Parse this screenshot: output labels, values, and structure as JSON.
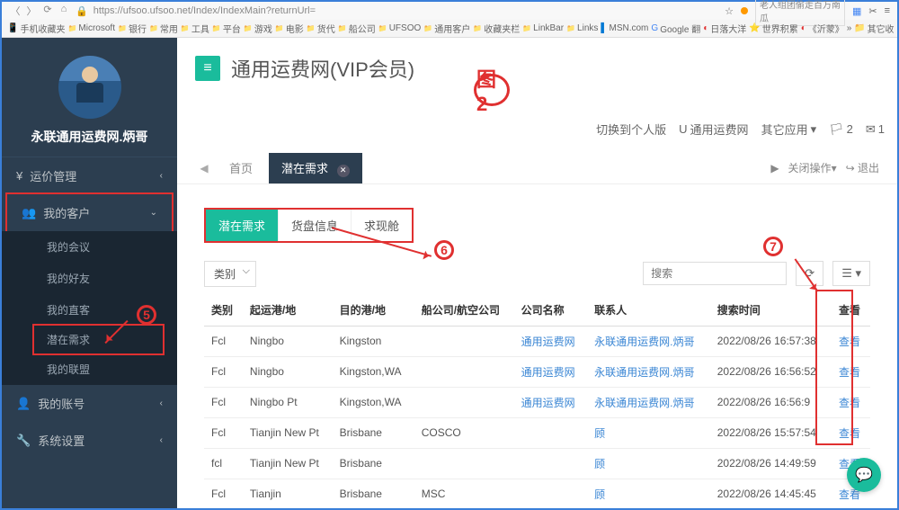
{
  "browser": {
    "url": "https://ufsoo.ufsoo.net/Index/IndexMain?returnUrl=",
    "search_placeholder": "老人组团偷走百万南瓜"
  },
  "bookmarks": [
    "手机收藏夹",
    "Microsoft",
    "银行",
    "常用",
    "工具",
    "平台",
    "游戏",
    "电影",
    "货代",
    "船公司",
    "UFSOO",
    "通用客户",
    "收藏夹栏",
    "LinkBar",
    "Links",
    "MSN.com",
    "Google 翻",
    "日落大洋",
    "世界积累",
    "《沂蒙》",
    "其它收"
  ],
  "profile": {
    "name": "永联通用运费网.炳哥"
  },
  "nav": {
    "freight": "运价管理",
    "customers": "我的客户",
    "customers_items": [
      "我的会议",
      "我的好友",
      "我的直客",
      "潜在需求",
      "我的联盟"
    ],
    "account": "我的账号",
    "settings": "系统设置"
  },
  "header": {
    "title": "通用运费网(VIP会员)",
    "switch": "切换到个人版",
    "ufs": "通用运费网",
    "apps": "其它应用",
    "badge1": "2",
    "badge2": "1"
  },
  "tabs": {
    "home": "首页",
    "active": "潜在需求",
    "close_ops": "关闭操作",
    "logout": "退出"
  },
  "sub_tabs": [
    "潜在需求",
    "货盘信息",
    "求现舱"
  ],
  "filter": {
    "category": "类别",
    "search_placeholder": "搜索"
  },
  "table": {
    "headers": [
      "类别",
      "起运港/地",
      "目的港/地",
      "船公司/航空公司",
      "公司名称",
      "联系人",
      "搜索时间",
      "查看"
    ],
    "rows": [
      {
        "cat": "Fcl",
        "origin": "Ningbo",
        "dest": "Kingston",
        "carrier": "",
        "company": "通用运费网",
        "contact": "永联通用运费网.炳哥",
        "time": "2022/08/26 16:57:38",
        "view": "查看"
      },
      {
        "cat": "Fcl",
        "origin": "Ningbo",
        "dest": "Kingston,WA",
        "carrier": "",
        "company": "通用运费网",
        "contact": "永联通用运费网.炳哥",
        "time": "2022/08/26 16:56:52",
        "view": "查看"
      },
      {
        "cat": "Fcl",
        "origin": "Ningbo Pt",
        "dest": "Kingston,WA",
        "carrier": "",
        "company": "通用运费网",
        "contact": "永联通用运费网.炳哥",
        "time": "2022/08/26 16:56:9",
        "view": "查看"
      },
      {
        "cat": "Fcl",
        "origin": "Tianjin New Pt",
        "dest": "Brisbane",
        "carrier": "COSCO",
        "company": "",
        "contact": "顾",
        "time": "2022/08/26 15:57:54",
        "view": "查看"
      },
      {
        "cat": "fcl",
        "origin": "Tianjin New Pt",
        "dest": "Brisbane",
        "carrier": "",
        "company": "",
        "contact": "顾",
        "time": "2022/08/26 14:49:59",
        "view": "查看"
      },
      {
        "cat": "Fcl",
        "origin": "Tianjin",
        "dest": "Brisbane",
        "carrier": "MSC",
        "company": "",
        "contact": "顾",
        "time": "2022/08/26 14:45:45",
        "view": "查看"
      }
    ]
  },
  "annotations": {
    "fig": "图2",
    "n5": "5",
    "n6": "6",
    "n7": "7"
  }
}
